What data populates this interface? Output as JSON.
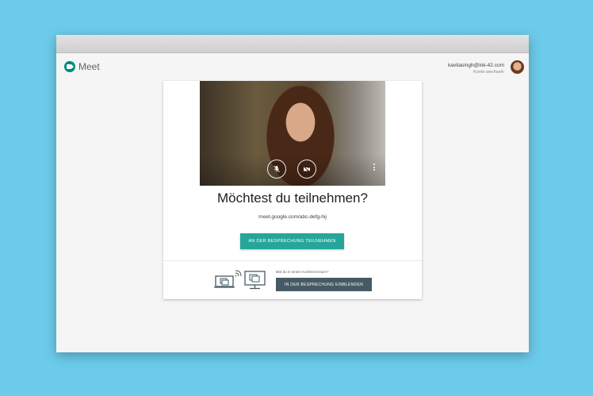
{
  "app": {
    "name": "Meet"
  },
  "account": {
    "email": "kavitasingh@ink-42.com",
    "switch_label": "Konto wechseln"
  },
  "card": {
    "title": "Möchtest du teilnehmen?",
    "meeting_link": "meet.google.com/abc-defg-hij",
    "join_button": "AN DER BESPRECHUNG TEILNEHMEN",
    "room_question": "Bist du in einem Konferenzraum?",
    "present_button": "IN DER BESPRECHUNG EINBLENDEN"
  },
  "icons": {
    "logo": "meet-logo-icon",
    "mic": "mic-off-icon",
    "camera": "camera-off-icon",
    "more": "more-vert-icon",
    "present": "present-to-room-icon"
  },
  "colors": {
    "background": "#6ccbea",
    "brand": "#00897b",
    "join_button": "#26a69a",
    "present_button": "#455a64"
  }
}
